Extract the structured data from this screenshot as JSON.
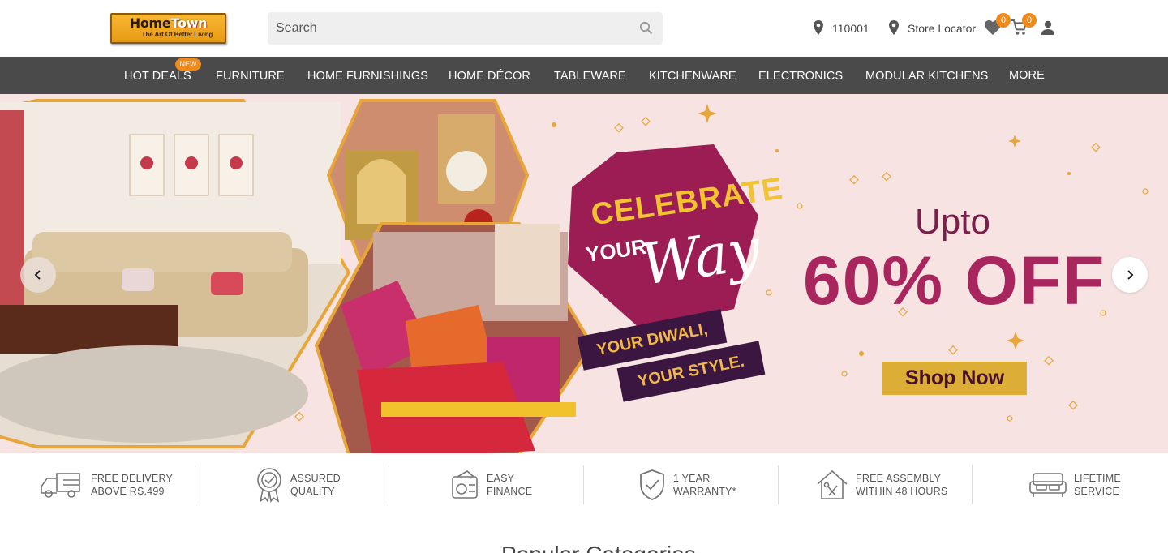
{
  "header": {
    "logo": {
      "brand_part1": "Home",
      "brand_part2": "Town",
      "tagline": "The Art Of Better Living"
    },
    "search": {
      "placeholder": "Search"
    },
    "pincode": "110001",
    "store_locator": "Store Locator",
    "wishlist_count": "0",
    "cart_count": "0"
  },
  "nav": {
    "items": [
      "HOT DEALS",
      "FURNITURE",
      "HOME FURNISHINGS",
      "HOME DÉCOR",
      "TABLEWARE",
      "KITCHENWARE",
      "ELECTRONICS",
      "MODULAR KITCHENS",
      "MORE"
    ],
    "new_badge": "NEW"
  },
  "banner": {
    "celebrate": "CELEBRATE",
    "your": "YOUR",
    "way": "Way",
    "diwali_line1": "YOUR DIWALI,",
    "diwali_line2": "YOUR STYLE.",
    "upto": "Upto",
    "discount": "60% OFF",
    "cta": "Shop Now"
  },
  "features": [
    {
      "line1": "FREE DELIVERY",
      "line2": "ABOVE RS.499",
      "icon": "truck-icon"
    },
    {
      "line1": "ASSURED",
      "line2": "QUALITY",
      "icon": "quality-badge-icon"
    },
    {
      "line1": "EASY",
      "line2": "FINANCE",
      "icon": "finance-icon"
    },
    {
      "line1": "1 YEAR",
      "line2": "WARRANTY*",
      "icon": "shield-check-icon"
    },
    {
      "line1": "FREE ASSEMBLY",
      "line2": "WITHIN 48 HOURS",
      "icon": "house-tools-icon"
    },
    {
      "line1": "LIFETIME",
      "line2": "SERVICE",
      "icon": "sofa-icon"
    }
  ],
  "section_heading": "Popular Categories",
  "colors": {
    "accent_orange": "#f08a1c",
    "nav_bg": "#4a4a4a",
    "banner_bg": "#f6e3e2",
    "discount_text": "#a8255d",
    "cta_bg": "#dcae35"
  }
}
